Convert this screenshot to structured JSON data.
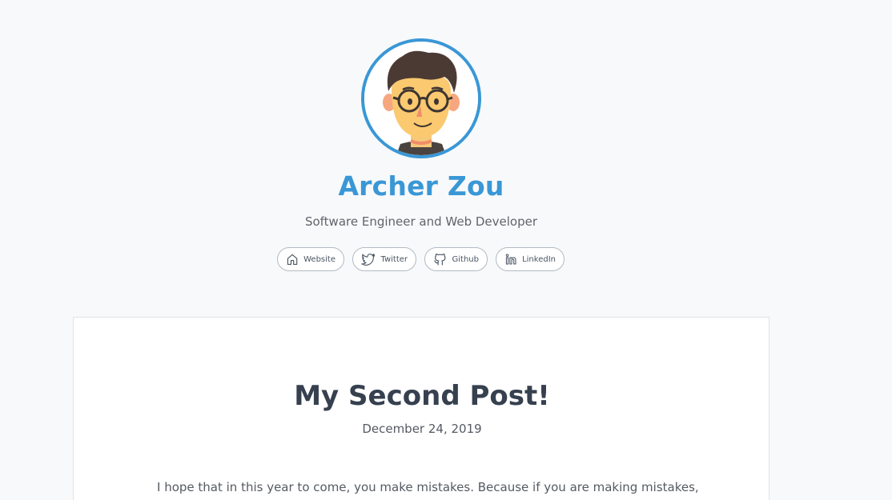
{
  "profile": {
    "name": "Archer Zou",
    "tagline": "Software Engineer and Web Developer",
    "avatar_icon": "cartoon-avatar-with-glasses"
  },
  "socials": [
    {
      "label": "Website",
      "icon": "home-icon"
    },
    {
      "label": "Twitter",
      "icon": "twitter-icon"
    },
    {
      "label": "Github",
      "icon": "github-icon"
    },
    {
      "label": "LinkedIn",
      "icon": "linkedin-icon"
    }
  ],
  "post": {
    "title": "My Second Post!",
    "date": "December 24, 2019",
    "body": "I hope that in this year to come, you make mistakes. Because if you are making mistakes,"
  },
  "colors": {
    "accent": "#3a97d6",
    "heading": "#36404f",
    "muted": "#60646b",
    "background": "#f7f9fa"
  }
}
